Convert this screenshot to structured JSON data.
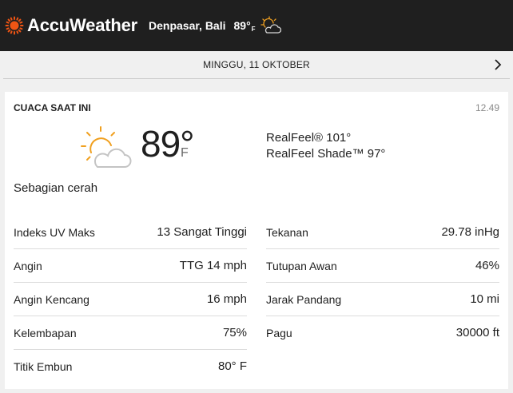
{
  "header": {
    "brand": "AccuWeather",
    "location": "Denpasar, Bali",
    "temp": "89°",
    "unit": "F",
    "icons": {
      "brand": "sun-logo-icon",
      "condition": "partly-sunny-icon"
    }
  },
  "datebar": {
    "date": "MINGGU, 11 OKTOBER",
    "next_icon": "chevron-right-icon"
  },
  "current": {
    "title": "CUACA SAAT INI",
    "time": "12.49",
    "temp": "89°",
    "unit": "F",
    "realfeel": "RealFeel® 101°",
    "realfeel_shade": "RealFeel Shade™ 97°",
    "phrase": "Sebagian cerah",
    "condition_icon": "partly-sunny-icon"
  },
  "details_left": [
    {
      "label": "Indeks UV Maks",
      "value": "13 Sangat Tinggi"
    },
    {
      "label": "Angin",
      "value": "TTG 14 mph"
    },
    {
      "label": "Angin Kencang",
      "value": "16 mph"
    },
    {
      "label": "Kelembapan",
      "value": "75%"
    },
    {
      "label": "Titik Embun",
      "value": "80° F"
    }
  ],
  "details_right": [
    {
      "label": "Tekanan",
      "value": "29.78 inHg"
    },
    {
      "label": "Tutupan Awan",
      "value": "46%"
    },
    {
      "label": "Jarak Pandang",
      "value": "10 mi"
    },
    {
      "label": "Pagu",
      "value": "30000 ft"
    }
  ],
  "colors": {
    "brand_orange": "#f05514",
    "icon_orange": "#f0a020",
    "header_bg": "#1f1f1f"
  }
}
